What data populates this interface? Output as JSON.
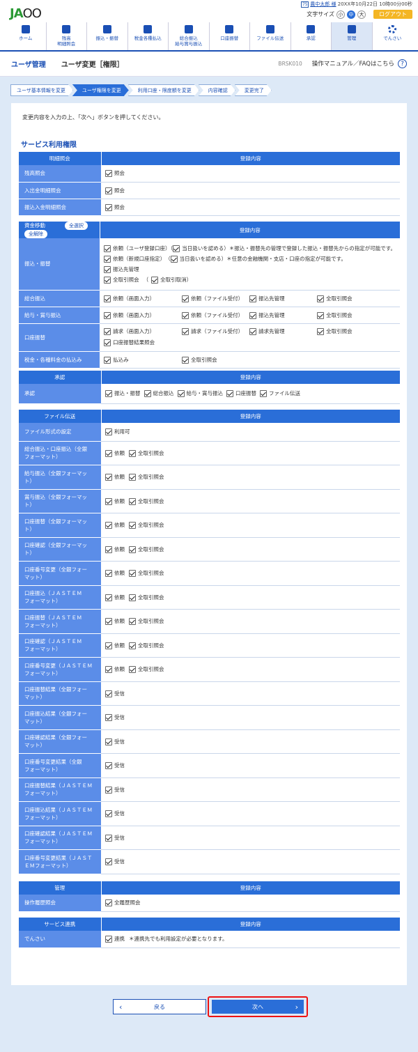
{
  "header": {
    "logo_ja": "JA",
    "logo_rest": "OO",
    "user_badge": "75",
    "user_name": "農中太郎 様",
    "last_login": "20XX年10月22日 10時00分00秒",
    "font_size_label": "文字サイズ",
    "font_sizes": [
      "小",
      "中",
      "大"
    ],
    "logout": "ログアウト"
  },
  "nav": [
    "ホーム",
    "残高|明細照会",
    "振込・振替",
    "税金各種払込",
    "総合振込|給与賞与振込",
    "口座振替",
    "ファイル伝送",
    "承認",
    "管理",
    "でんさい"
  ],
  "title": {
    "section": "ユーザ管理",
    "page": "ユーザ変更［権限］",
    "code": "BRSK010",
    "help": "操作マニュアル／FAQはこちら",
    "help_icon": "?"
  },
  "steps": [
    "ユーザ基本情報を変更",
    "ユーザ権限を変更",
    "利用口座・限度額を変更",
    "内容確認",
    "変更完了"
  ],
  "instruction": "変更内容を入力の上、「次へ」ボタンを押してください。",
  "section_title": "サービス利用権限",
  "col_content": "登録内容",
  "t1": {
    "h": "明細照会",
    "rows": [
      [
        "残高照会",
        "照会"
      ],
      [
        "入出金明細照会",
        "照会"
      ],
      [
        "振込入金明細照会",
        "照会"
      ]
    ]
  },
  "t2": {
    "h": "資金移動",
    "select_all": "全選択",
    "deselect_all": "全解除",
    "furikomi_label": "振込・振替",
    "f_l1a": "依頼（ユーザ登録口座）（",
    "f_l1b": "当日扱いを認める",
    "f_l1c": "）＊振込・振替先の管理で登録した振込・振替先からの指定が可能です。",
    "f_l2a": "依頼（新規口座指定）　（",
    "f_l2b": "当日扱いを認める",
    "f_l2c": "）＊任意の金融機関・支店・口座の指定が可能です。",
    "f_l3": "振込先管理",
    "f_l4a": "全取引照会",
    "f_l4b": "（",
    "f_l4c": "全取引取消",
    "f_l4d": "）",
    "sogo_label": "総合振込",
    "kyuyo_label": "給与・賞与振込",
    "koza_label": "口座振替",
    "zeikin_label": "税金・各種料金の払込み",
    "r4a": [
      "依頼（画面入力）",
      "依頼（ファイル受付）",
      "振込先管理",
      "全取引照会"
    ],
    "r4c": [
      "請求（画面入力）",
      "請求（ファイル受付）",
      "請求先管理",
      "全取引照会"
    ],
    "koza_extra": "口座振替結果照会",
    "zeikin": [
      "払込み",
      "全取引照会"
    ]
  },
  "t3": {
    "h": "承認",
    "label": "承認",
    "items": [
      "振込・振替",
      "総合振込",
      "給与・賞与振込",
      "口座振替",
      "ファイル伝送"
    ]
  },
  "t4": {
    "h": "ファイル伝送",
    "fmt_label": "ファイル形式の設定",
    "fmt_val": "利用可",
    "req": "依頼",
    "all": "全取引照会",
    "recv": "受信",
    "rows_req": [
      "総合振込・口座振込（全銀|フォーマット）",
      "給与振込（全銀フォーマッ|ト）",
      "賞与振込（全銀フォーマッ|ト）",
      "口座振替（全銀フォーマッ|ト）",
      "口座確認（全銀フォーマッ|ト）",
      "口座番号変更（全銀フォー|マット）",
      "口座振込（ＪＡＳＴＥＭ|フォーマット）",
      "口座振替（ＪＡＳＴＥＭ|フォーマット）",
      "口座確認（ＪＡＳＴＥＭ|フォーマット）",
      "口座番号変更（ＪＡＳＴＥＭ|フォーマット）"
    ],
    "rows_recv": [
      "口座振替結果（全銀フォー|マット）",
      "口座振込結果（全銀フォー|マット）",
      "口座確認結果（全銀フォー|マット）",
      "口座番号変更結果（全銀|フォーマット）",
      "口座振替結果（ＪＡＳＴＥＭ|フォーマット）",
      "口座振込結果（ＪＡＳＴＥＭ|フォーマット）",
      "口座確認結果（ＪＡＳＴＥＭ|フォーマット）",
      "口座番号変更結果（ＪＡＳＴ|ＥＭフォーマット）"
    ]
  },
  "t5": {
    "h": "管理",
    "label": "操作履歴照会",
    "val": "全履歴照会"
  },
  "t6": {
    "h": "サービス連携",
    "label": "でんさい",
    "val": "連携",
    "note": "＊連携先でも利用設定が必要となります。"
  },
  "buttons": {
    "back": "戻る",
    "next": "次へ",
    "back_icon": "‹",
    "next_icon": "›"
  }
}
